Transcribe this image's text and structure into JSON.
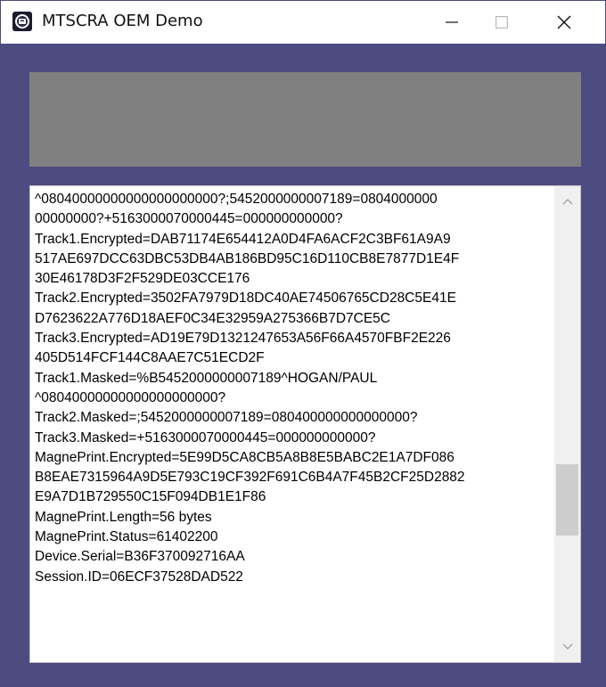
{
  "window": {
    "title": "MTSCRA OEM Demo",
    "icons": {
      "app": "magtek-app-icon",
      "minimize": "minimize-icon",
      "maximize": "maximize-icon",
      "close": "close-icon"
    }
  },
  "colors": {
    "window_background": "#4d4c80",
    "gray_panel": "#808080",
    "textbox_background": "#ffffff",
    "scroll_thumb": "#cdcdcd"
  },
  "output": {
    "lines": [
      "^08040000000000000000000?;5452000000007189=0804000000",
      "00000000?+5163000070000445=000000000000?",
      "Track1.Encrypted=DAB71174E654412A0D4FA6ACF2C3BF61A9A9",
      "517AE697DCC63DBC53DB4AB186BD95C16D110CB8E7877D1E4F",
      "30E46178D3F2F529DE03CCE176",
      "Track2.Encrypted=3502FA7979D18DC40AE74506765CD28C5E41E",
      "D7623622A776D18AEF0C34E32959A275366B7D7CE5C",
      "Track3.Encrypted=AD19E79D1321247653A56F66A4570FBF2E226",
      "405D514FCF144C8AAE7C51ECD2F",
      "Track1.Masked=%B5452000000007189^HOGAN/PAUL",
      "^08040000000000000000000?",
      "Track2.Masked=;5452000000007189=080400000000000000?",
      "Track3.Masked=+5163000070000445=000000000000?",
      "MagnePrint.Encrypted=5E99D5CA8CB5A8B8E5BABC2E1A7DF086",
      "B8EAE7315964A9D5E793C19CF392F691C6B4A7F45B2CF25D2882",
      "E9A7D1B729550C15F094DB1E1F86",
      "MagnePrint.Length=56 bytes",
      "MagnePrint.Status=61402200",
      "Device.Serial=B36F370092716AA",
      "Session.ID=06ECF37528DAD522"
    ]
  },
  "scrollbar": {
    "position_fraction": 0.72,
    "up_icon": "chevron-up-icon",
    "down_icon": "chevron-down-icon"
  }
}
